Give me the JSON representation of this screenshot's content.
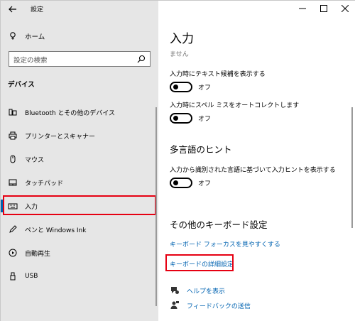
{
  "window": {
    "title": "設定",
    "controls": [
      "minimize-icon",
      "maximize-icon",
      "close-icon"
    ]
  },
  "sidebar": {
    "home_label": "ホーム",
    "search_placeholder": "設定の検索",
    "section_heading": "デバイス",
    "items": [
      {
        "label": "Bluetooth とその他のデバイス",
        "icon": "bluetooth-devices-icon"
      },
      {
        "label": "プリンターとスキャナー",
        "icon": "printer-icon"
      },
      {
        "label": "マウス",
        "icon": "mouse-icon"
      },
      {
        "label": "タッチパッド",
        "icon": "touchpad-icon"
      },
      {
        "label": "入力",
        "icon": "keyboard-icon",
        "selected": true
      },
      {
        "label": "ペンと Windows Ink",
        "icon": "pen-icon"
      },
      {
        "label": "自動再生",
        "icon": "autoplay-icon"
      },
      {
        "label": "USB",
        "icon": "usb-icon"
      }
    ]
  },
  "main": {
    "title": "入力",
    "subtitle": "ません",
    "settings": [
      {
        "label": "入力時にテキスト候補を表示する",
        "state": "オフ"
      },
      {
        "label": "入力時にスペル ミスをオートコレクトします",
        "state": "オフ"
      }
    ],
    "multilingual": {
      "title": "多言語のヒント",
      "label": "入力から識別された言語に基づいて入力ヒントを表示する",
      "state": "オフ"
    },
    "keyboard": {
      "title": "その他のキーボード設定",
      "links": [
        "キーボード フォーカスを見やすくする",
        "キーボードの詳細設定"
      ]
    },
    "help": [
      {
        "label": "ヘルプを表示",
        "icon": "help-chat-icon"
      },
      {
        "label": "フィードバックの送信",
        "icon": "feedback-icon"
      }
    ]
  },
  "colors": {
    "accent": "#0063b1",
    "highlight_red": "#e60012",
    "sidebar_bg": "#e6e6e6"
  }
}
